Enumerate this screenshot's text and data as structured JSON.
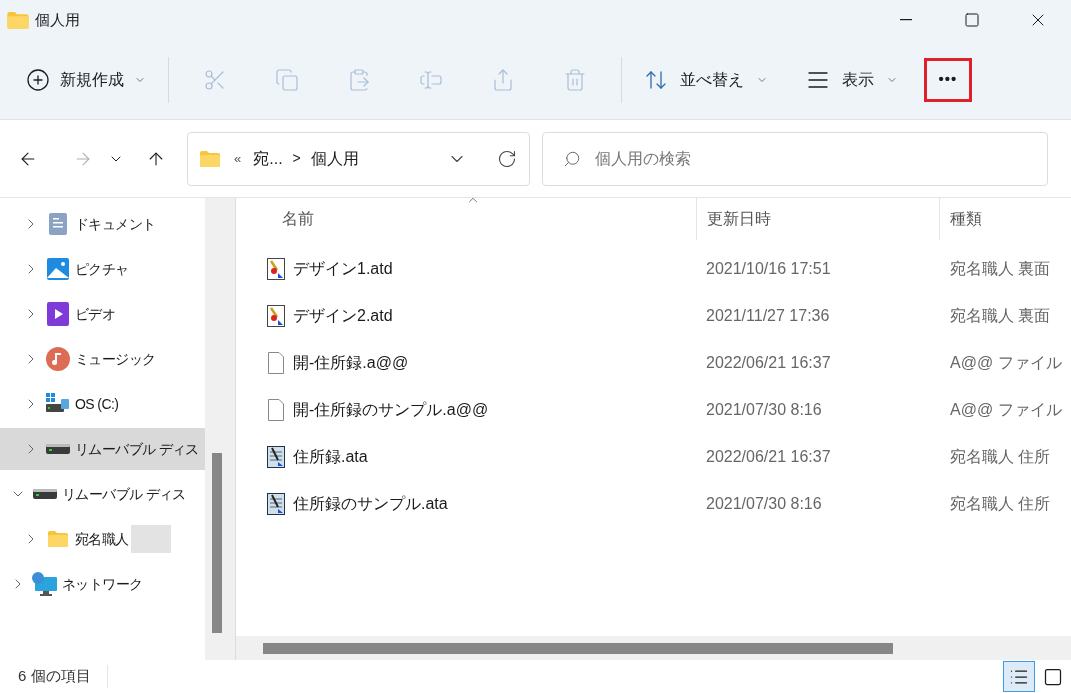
{
  "window": {
    "title": "個人用"
  },
  "toolbar": [
    {
      "kind": "new",
      "label": "新規作成",
      "disabled": false,
      "dropdown": true
    },
    {
      "kind": "divider"
    },
    {
      "kind": "cut",
      "disabled": true
    },
    {
      "kind": "copy",
      "disabled": true
    },
    {
      "kind": "paste",
      "disabled": true
    },
    {
      "kind": "rename",
      "disabled": true
    },
    {
      "kind": "share",
      "disabled": true
    },
    {
      "kind": "delete",
      "disabled": true
    },
    {
      "kind": "divider"
    },
    {
      "kind": "sort",
      "label": "並べ替え",
      "disabled": false,
      "dropdown": true
    },
    {
      "kind": "view",
      "label": "表示",
      "disabled": false,
      "dropdown": true
    },
    {
      "kind": "more",
      "label": "•••",
      "disabled": false,
      "highlighted": true
    }
  ],
  "address": {
    "prefix": "«",
    "crumbs": [
      "宛...",
      "個人用"
    ],
    "separator": ">",
    "forward_disabled": true
  },
  "search": {
    "placeholder": "個人用の検索"
  },
  "sidebar": {
    "items": [
      {
        "kind": "group",
        "children": [
          {
            "kind": "documents",
            "label": "ドキュメント",
            "selected": false,
            "expanded": false
          },
          {
            "kind": "pictures",
            "label": "ピクチャ",
            "selected": false,
            "expanded": false
          },
          {
            "kind": "videos",
            "label": "ビデオ",
            "selected": false,
            "expanded": false
          },
          {
            "kind": "music",
            "label": "ミュージック",
            "selected": false,
            "expanded": false
          },
          {
            "kind": "os_drive",
            "label": "OS (C:)",
            "selected": false,
            "expanded": false
          },
          {
            "kind": "drive",
            "label": "リムーバブル ディス",
            "selected": true,
            "expanded": false
          }
        ]
      },
      {
        "kind": "drive",
        "label": "リムーバブル ディス",
        "selected": false,
        "expanded": true,
        "children": [
          {
            "kind": "folder",
            "label": "宛名職人",
            "selected": false,
            "expanded": false,
            "redacted": true
          }
        ]
      },
      {
        "kind": "network",
        "label": "ネットワーク",
        "selected": false,
        "expanded": false
      }
    ]
  },
  "table": {
    "columns": [
      {
        "label": "名前",
        "sorted": true
      },
      {
        "label": "更新日時",
        "sorted": false
      },
      {
        "label": "種類",
        "sorted": false
      }
    ],
    "rows": [
      {
        "kind": "design",
        "name": "デザイン1.atd",
        "modified": "2021/10/16 17:51",
        "type": "宛名職人 裏面"
      },
      {
        "kind": "design",
        "name": "デザイン2.atd",
        "modified": "2021/11/27 17:36",
        "type": "宛名職人 裏面"
      },
      {
        "kind": "blank",
        "name": "開-住所録.a@@",
        "modified": "2022/06/21 16:37",
        "type": "A@@ ファイル"
      },
      {
        "kind": "blank",
        "name": "開-住所録のサンプル.a@@",
        "modified": "2021/07/30 8:16",
        "type": "A@@ ファイル"
      },
      {
        "kind": "address_book",
        "name": "住所録.ata",
        "modified": "2022/06/21 16:37",
        "type": "宛名職人 住所"
      },
      {
        "kind": "address_book",
        "name": "住所録のサンプル.ata",
        "modified": "2021/07/30 8:16",
        "type": "宛名職人 住所"
      }
    ]
  },
  "status_bar": {
    "count": "6 個の項目",
    "views": [
      {
        "kind": "details",
        "selected": true
      },
      {
        "kind": "tiles",
        "selected": false
      }
    ]
  }
}
